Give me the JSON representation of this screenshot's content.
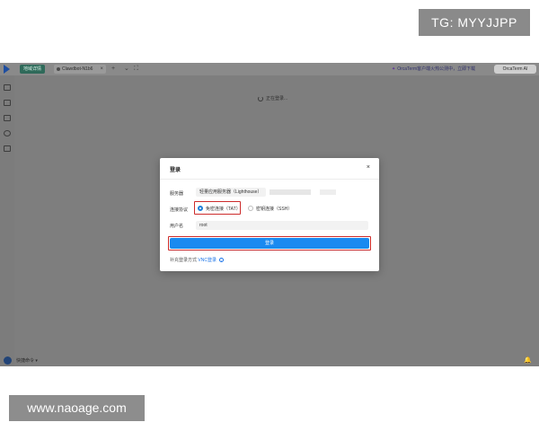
{
  "watermarks": {
    "tg": "TG: MYYJJPP",
    "site": "www.naoage.com"
  },
  "topbar": {
    "env_tag": "地域详情",
    "tab_label": "Clawdbot-N1b6",
    "tab_close": "×",
    "add_tab": "+",
    "chevron": "⌄",
    "split": "⛶",
    "announcement": "OrcaTerm客户端火热公测中，立即下载",
    "orca_button": "OrcaTerm AI"
  },
  "main": {
    "loading_text": "正在登录..."
  },
  "bottombar": {
    "quick_command": "快捷命令 ▾",
    "bell": "🔔"
  },
  "dialog": {
    "title": "登录",
    "close": "×",
    "server_label": "服务器",
    "server_value": "轻量应用服务器（Lighthouse）",
    "protocol_label": "连接协议",
    "protocol_options": [
      {
        "label": "免密连接（TAT）",
        "selected": true
      },
      {
        "label": "密钥连接（SSH）",
        "selected": false
      }
    ],
    "username_label": "用户名",
    "username_value": "root",
    "login_button": "登录",
    "supplement_label": "补充登录方式",
    "vnc_link": "VNC登录",
    "info_icon": "i"
  },
  "colors": {
    "overlay": "#7e7e7e",
    "primary": "#1a8af0",
    "highlight": "#cc2b2b"
  }
}
